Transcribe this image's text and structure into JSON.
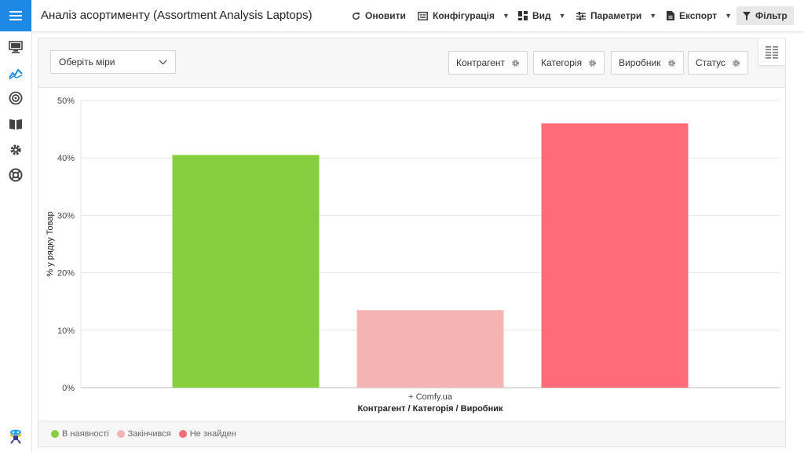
{
  "app": {
    "title": "Аналіз асортименту (Assortment Analysis Laptops)"
  },
  "sidebar": {
    "items": [
      {
        "icon": "monitor-icon"
      },
      {
        "icon": "chart-icon"
      },
      {
        "icon": "target-icon"
      },
      {
        "icon": "book-icon"
      },
      {
        "icon": "gear-icon"
      },
      {
        "icon": "lifebuoy-icon"
      }
    ],
    "bottom_icon": "mascot-icon"
  },
  "toolbar": {
    "refresh_label": "Оновити",
    "config_label": "Конфігурація",
    "view_label": "Вид",
    "params_label": "Параметри",
    "export_label": "Експорт",
    "filter_label": "Фільтр"
  },
  "controls": {
    "measures_placeholder": "Оберіть міри",
    "fields": [
      "Контрагент",
      "Категорія",
      "Виробник",
      "Статус"
    ]
  },
  "colors": {
    "accent": "#1e88e5",
    "in_stock": "#86d03f",
    "ended": "#f4b4b4",
    "not_found": "#ff6b78"
  },
  "chart_data": {
    "type": "bar",
    "categories": [
      "+ Comfy.ua"
    ],
    "series": [
      {
        "name": "В наявності",
        "values": [
          40.5
        ]
      },
      {
        "name": "Закінчився",
        "values": [
          13.5
        ]
      },
      {
        "name": "Не знайден",
        "values": [
          46
        ]
      }
    ],
    "ylabel": "% у рядку Товар",
    "xlabel": "Контрагент / Категорія / Виробник",
    "yticks": [
      "0%",
      "10%",
      "20%",
      "30%",
      "40%",
      "50%"
    ],
    "ylim": [
      0,
      50
    ],
    "grid": true,
    "legend": "bottom-left"
  }
}
